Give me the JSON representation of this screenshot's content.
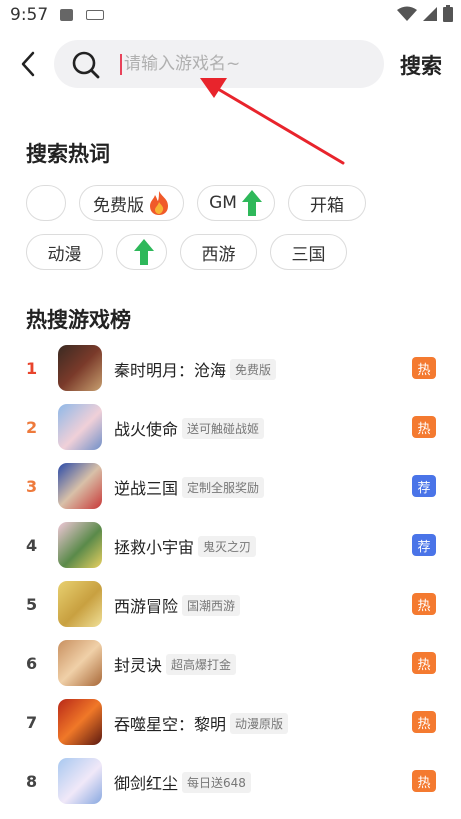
{
  "status_bar": {
    "time": "9:57"
  },
  "search": {
    "placeholder": "请输入游戏名~",
    "value": "",
    "button_label": "搜索"
  },
  "hot_words": {
    "title": "搜索热词",
    "chips": [
      {
        "label": "",
        "icon": ""
      },
      {
        "label": "免费版",
        "icon": "fire-icon"
      },
      {
        "label": "GM",
        "icon": "up-arrow-icon"
      },
      {
        "label": "开箱",
        "icon": ""
      },
      {
        "label": "动漫",
        "icon": ""
      },
      {
        "label": "",
        "icon": "up-arrow-icon"
      },
      {
        "label": "西游",
        "icon": ""
      },
      {
        "label": "三国",
        "icon": ""
      }
    ]
  },
  "ranking": {
    "title": "热搜游戏榜",
    "items": [
      {
        "rank": "1",
        "name": "秦时明月：沧海",
        "tag": "免费版",
        "badge": "热",
        "badge_type": "hot"
      },
      {
        "rank": "2",
        "name": "战火使命",
        "tag": "送可触碰战姬",
        "badge": "热",
        "badge_type": "hot"
      },
      {
        "rank": "3",
        "name": "逆战三国",
        "tag": "定制全服奖励",
        "badge": "荐",
        "badge_type": "rec"
      },
      {
        "rank": "4",
        "name": "拯救小宇宙",
        "tag": "鬼灭之刃",
        "badge": "荐",
        "badge_type": "rec"
      },
      {
        "rank": "5",
        "name": "西游冒险",
        "tag": "国潮西游",
        "badge": "热",
        "badge_type": "hot"
      },
      {
        "rank": "6",
        "name": "封灵诀",
        "tag": "超高爆打金",
        "badge": "热",
        "badge_type": "hot"
      },
      {
        "rank": "7",
        "name": "吞噬星空：黎明",
        "tag": "动漫原版",
        "badge": "热",
        "badge_type": "hot"
      },
      {
        "rank": "8",
        "name": "御剑红尘",
        "tag": "每日送648",
        "badge": "热",
        "badge_type": "hot"
      }
    ]
  },
  "colors": {
    "rank_top": "#e8442c",
    "rank_mid": "#ee7a3c",
    "rank_normal": "#444444",
    "badge_hot": "#f47a30",
    "badge_rec": "#4a74e8",
    "arrow_green": "#2eb85a",
    "annotation_red": "#e8242c"
  }
}
